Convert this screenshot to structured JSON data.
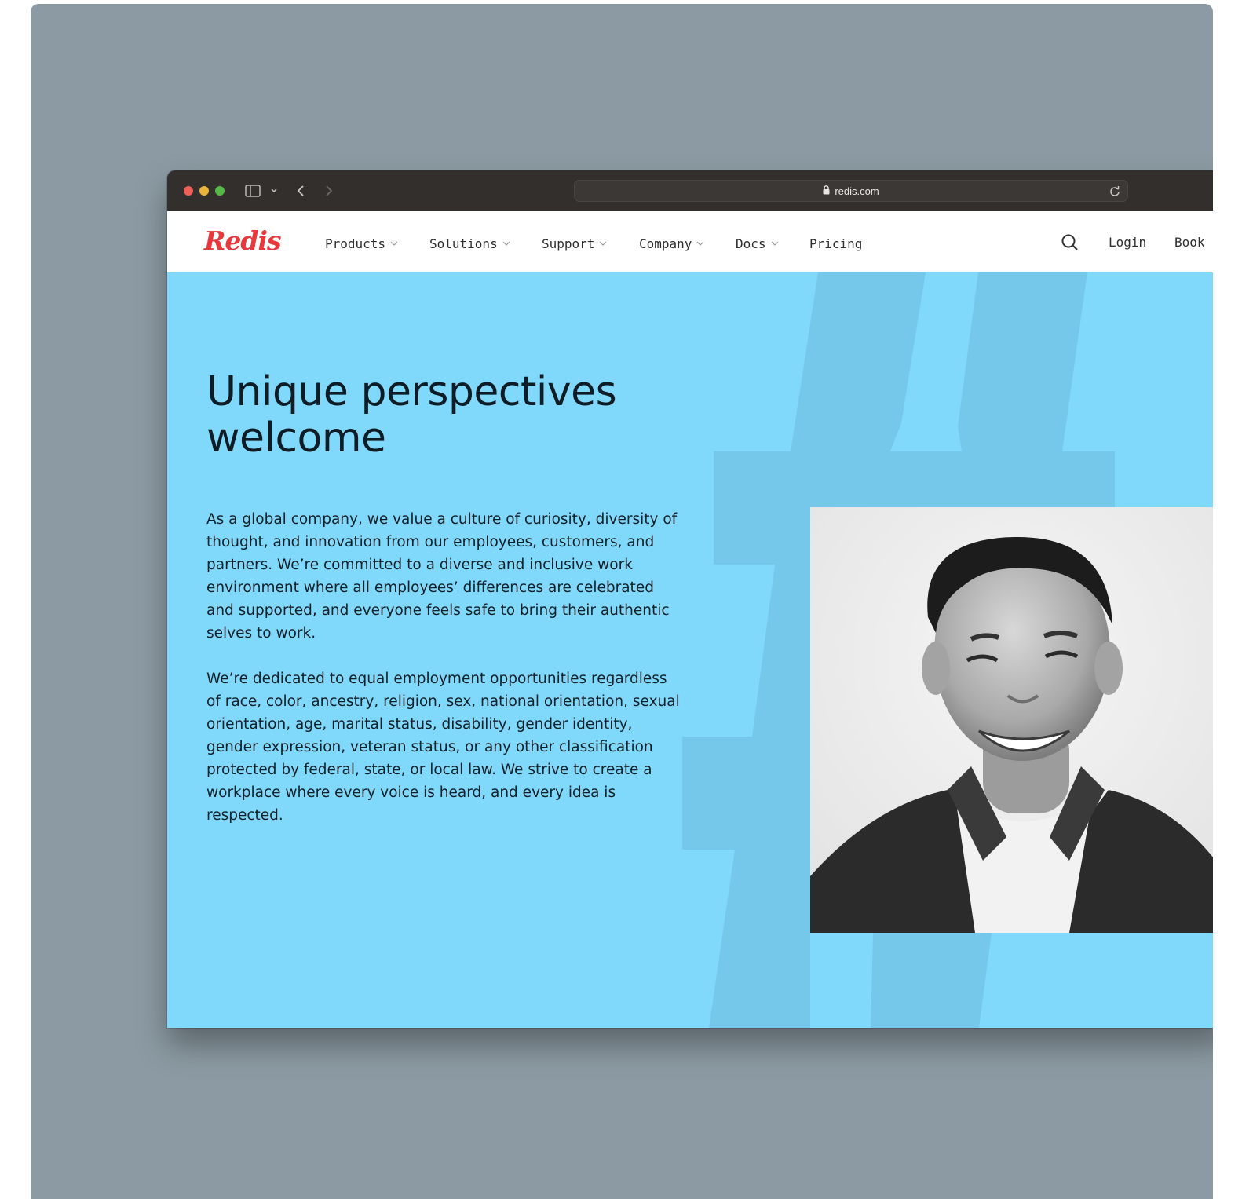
{
  "browser": {
    "url": "redis.com"
  },
  "nav": {
    "logo": "Redis",
    "items": [
      {
        "label": "Products"
      },
      {
        "label": "Solutions"
      },
      {
        "label": "Support"
      },
      {
        "label": "Company"
      },
      {
        "label": "Docs"
      },
      {
        "label": "Pricing"
      }
    ],
    "login": "Login",
    "book": "Book"
  },
  "hero": {
    "title": "Unique perspectives welcome",
    "paragraph1": "As a global company, we value a culture of curiosity, diversity of thought, and innovation from our employees, customers, and partners. We’re committed to a diverse and inclusive work environment where all employees’ differences are celebrated and supported, and everyone feels safe to bring their authentic selves to work.",
    "paragraph2": "We’re dedicated to equal employment opportunities regardless of race, color, ancestry, religion, sex, national orientation, sexual orientation, age, marital status, disability, gender identity, gender expression, veteran status, or any other classification protected by federal, state, or local law. We strive to create a workplace where every voice is heard, and every idea is respected."
  },
  "colors": {
    "backdrop": "#8c9ba3",
    "titlebar": "#332f2d",
    "hero_bg": "#80d8fb",
    "hash_shape": "#76c8eb",
    "logo": "#e8383b",
    "heading": "#0e1c26"
  },
  "icons": [
    "sidebar-icon",
    "chevron-down-icon",
    "back-arrow-icon",
    "forward-arrow-icon",
    "lock-icon",
    "reload-icon",
    "search-icon"
  ]
}
